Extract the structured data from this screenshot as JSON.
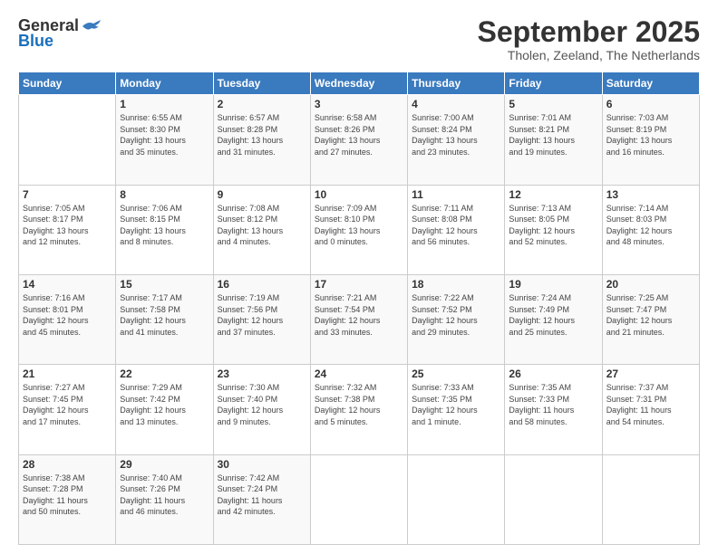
{
  "logo": {
    "general": "General",
    "blue": "Blue"
  },
  "header": {
    "month": "September 2025",
    "location": "Tholen, Zeeland, The Netherlands"
  },
  "weekdays": [
    "Sunday",
    "Monday",
    "Tuesday",
    "Wednesday",
    "Thursday",
    "Friday",
    "Saturday"
  ],
  "weeks": [
    [
      {
        "day": "",
        "info": ""
      },
      {
        "day": "1",
        "info": "Sunrise: 6:55 AM\nSunset: 8:30 PM\nDaylight: 13 hours\nand 35 minutes."
      },
      {
        "day": "2",
        "info": "Sunrise: 6:57 AM\nSunset: 8:28 PM\nDaylight: 13 hours\nand 31 minutes."
      },
      {
        "day": "3",
        "info": "Sunrise: 6:58 AM\nSunset: 8:26 PM\nDaylight: 13 hours\nand 27 minutes."
      },
      {
        "day": "4",
        "info": "Sunrise: 7:00 AM\nSunset: 8:24 PM\nDaylight: 13 hours\nand 23 minutes."
      },
      {
        "day": "5",
        "info": "Sunrise: 7:01 AM\nSunset: 8:21 PM\nDaylight: 13 hours\nand 19 minutes."
      },
      {
        "day": "6",
        "info": "Sunrise: 7:03 AM\nSunset: 8:19 PM\nDaylight: 13 hours\nand 16 minutes."
      }
    ],
    [
      {
        "day": "7",
        "info": "Sunrise: 7:05 AM\nSunset: 8:17 PM\nDaylight: 13 hours\nand 12 minutes."
      },
      {
        "day": "8",
        "info": "Sunrise: 7:06 AM\nSunset: 8:15 PM\nDaylight: 13 hours\nand 8 minutes."
      },
      {
        "day": "9",
        "info": "Sunrise: 7:08 AM\nSunset: 8:12 PM\nDaylight: 13 hours\nand 4 minutes."
      },
      {
        "day": "10",
        "info": "Sunrise: 7:09 AM\nSunset: 8:10 PM\nDaylight: 13 hours\nand 0 minutes."
      },
      {
        "day": "11",
        "info": "Sunrise: 7:11 AM\nSunset: 8:08 PM\nDaylight: 12 hours\nand 56 minutes."
      },
      {
        "day": "12",
        "info": "Sunrise: 7:13 AM\nSunset: 8:05 PM\nDaylight: 12 hours\nand 52 minutes."
      },
      {
        "day": "13",
        "info": "Sunrise: 7:14 AM\nSunset: 8:03 PM\nDaylight: 12 hours\nand 48 minutes."
      }
    ],
    [
      {
        "day": "14",
        "info": "Sunrise: 7:16 AM\nSunset: 8:01 PM\nDaylight: 12 hours\nand 45 minutes."
      },
      {
        "day": "15",
        "info": "Sunrise: 7:17 AM\nSunset: 7:58 PM\nDaylight: 12 hours\nand 41 minutes."
      },
      {
        "day": "16",
        "info": "Sunrise: 7:19 AM\nSunset: 7:56 PM\nDaylight: 12 hours\nand 37 minutes."
      },
      {
        "day": "17",
        "info": "Sunrise: 7:21 AM\nSunset: 7:54 PM\nDaylight: 12 hours\nand 33 minutes."
      },
      {
        "day": "18",
        "info": "Sunrise: 7:22 AM\nSunset: 7:52 PM\nDaylight: 12 hours\nand 29 minutes."
      },
      {
        "day": "19",
        "info": "Sunrise: 7:24 AM\nSunset: 7:49 PM\nDaylight: 12 hours\nand 25 minutes."
      },
      {
        "day": "20",
        "info": "Sunrise: 7:25 AM\nSunset: 7:47 PM\nDaylight: 12 hours\nand 21 minutes."
      }
    ],
    [
      {
        "day": "21",
        "info": "Sunrise: 7:27 AM\nSunset: 7:45 PM\nDaylight: 12 hours\nand 17 minutes."
      },
      {
        "day": "22",
        "info": "Sunrise: 7:29 AM\nSunset: 7:42 PM\nDaylight: 12 hours\nand 13 minutes."
      },
      {
        "day": "23",
        "info": "Sunrise: 7:30 AM\nSunset: 7:40 PM\nDaylight: 12 hours\nand 9 minutes."
      },
      {
        "day": "24",
        "info": "Sunrise: 7:32 AM\nSunset: 7:38 PM\nDaylight: 12 hours\nand 5 minutes."
      },
      {
        "day": "25",
        "info": "Sunrise: 7:33 AM\nSunset: 7:35 PM\nDaylight: 12 hours\nand 1 minute."
      },
      {
        "day": "26",
        "info": "Sunrise: 7:35 AM\nSunset: 7:33 PM\nDaylight: 11 hours\nand 58 minutes."
      },
      {
        "day": "27",
        "info": "Sunrise: 7:37 AM\nSunset: 7:31 PM\nDaylight: 11 hours\nand 54 minutes."
      }
    ],
    [
      {
        "day": "28",
        "info": "Sunrise: 7:38 AM\nSunset: 7:28 PM\nDaylight: 11 hours\nand 50 minutes."
      },
      {
        "day": "29",
        "info": "Sunrise: 7:40 AM\nSunset: 7:26 PM\nDaylight: 11 hours\nand 46 minutes."
      },
      {
        "day": "30",
        "info": "Sunrise: 7:42 AM\nSunset: 7:24 PM\nDaylight: 11 hours\nand 42 minutes."
      },
      {
        "day": "",
        "info": ""
      },
      {
        "day": "",
        "info": ""
      },
      {
        "day": "",
        "info": ""
      },
      {
        "day": "",
        "info": ""
      }
    ]
  ]
}
